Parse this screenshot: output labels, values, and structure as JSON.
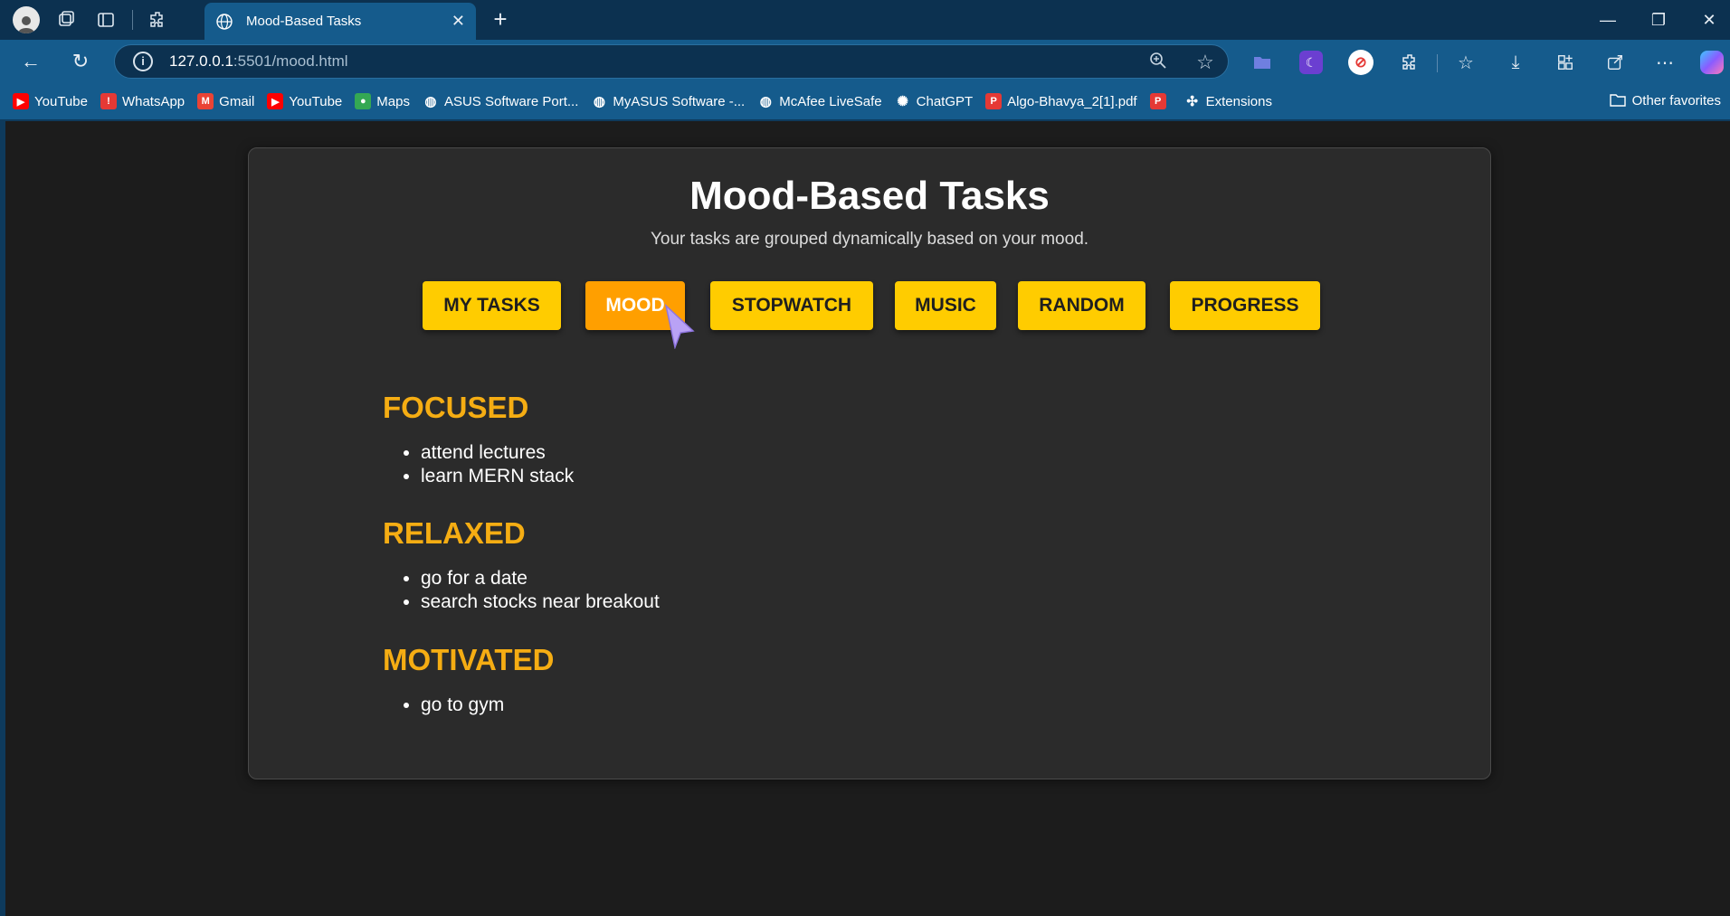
{
  "browser": {
    "tab_title": "Mood-Based Tasks",
    "url_host": "127.0.0.1",
    "url_rest": ":5501/mood.html",
    "bookmarks": [
      {
        "label": "YouTube",
        "icon": "youtube-icon",
        "color": "#ff0000"
      },
      {
        "label": "WhatsApp",
        "icon": "whatsapp-icon",
        "color": "#e53935"
      },
      {
        "label": "Gmail",
        "icon": "gmail-icon",
        "color": "#ea4335"
      },
      {
        "label": "YouTube",
        "icon": "youtube-icon",
        "color": "#ff0000"
      },
      {
        "label": "Maps",
        "icon": "maps-icon",
        "color": "#34a853"
      },
      {
        "label": "ASUS Software Port...",
        "icon": "globe-icon",
        "color": "#ffffff"
      },
      {
        "label": "MyASUS Software -...",
        "icon": "globe-icon",
        "color": "#ffffff"
      },
      {
        "label": "McAfee LiveSafe",
        "icon": "globe-icon",
        "color": "#ffffff"
      },
      {
        "label": "ChatGPT",
        "icon": "chatgpt-icon",
        "color": "#ffffff"
      },
      {
        "label": "Algo-Bhavya_2[1].pdf",
        "icon": "pdf-icon",
        "color": "#e53935"
      },
      {
        "label": "",
        "icon": "pdf-icon",
        "color": "#e53935"
      },
      {
        "label": "Extensions",
        "icon": "puzzle-icon",
        "color": "#ffffff"
      }
    ],
    "other_favorites": "Other favorites"
  },
  "page": {
    "title": "Mood-Based Tasks",
    "subtitle": "Your tasks are grouped dynamically based on your mood.",
    "nav": [
      "MY TASKS",
      "MOOD",
      "STOPWATCH",
      "MUSIC",
      "RANDOM",
      "PROGRESS"
    ],
    "active_nav": "MOOD",
    "moods": [
      {
        "name": "FOCUSED",
        "tasks": [
          "attend lectures",
          "learn MERN stack"
        ]
      },
      {
        "name": "RELAXED",
        "tasks": [
          "go for a date",
          "search stocks near breakout"
        ]
      },
      {
        "name": "MOTIVATED",
        "tasks": [
          "go to gym"
        ]
      }
    ]
  },
  "colors": {
    "button": "#ffcc00",
    "button_active": "#ff9f00",
    "mood_heading": "#f5ad13",
    "card_bg": "#2b2b2b",
    "page_bg": "#1c1c1c"
  }
}
